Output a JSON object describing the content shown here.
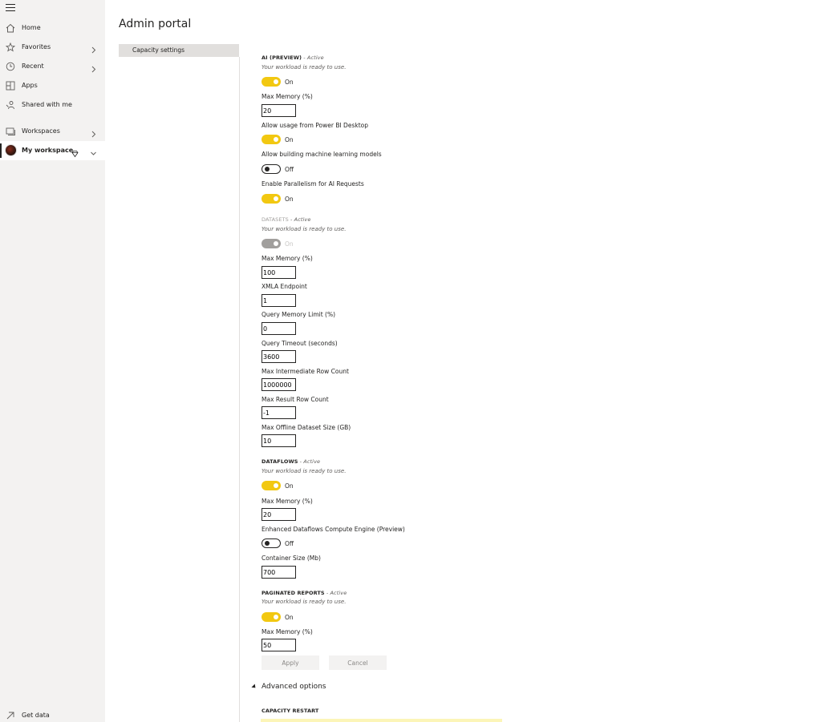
{
  "nav": {
    "items": [
      {
        "label": "Home",
        "icon": "home-icon"
      },
      {
        "label": "Favorites",
        "icon": "star-icon"
      },
      {
        "label": "Recent",
        "icon": "clock-icon"
      },
      {
        "label": "Apps",
        "icon": "apps-icon"
      },
      {
        "label": "Shared with me",
        "icon": "shared-icon"
      },
      {
        "label": "Workspaces",
        "icon": "workspaces-icon"
      },
      {
        "label": "My workspace",
        "icon": "avatar"
      }
    ],
    "get_data": "Get data"
  },
  "page": {
    "title": "Admin portal",
    "subnav_item": "Capacity settings"
  },
  "ai": {
    "name": "AI (PREVIEW)",
    "status": " - Active",
    "note": "Your workload is ready to use.",
    "toggle_label": "On",
    "max_memory_label": "Max Memory (%)",
    "max_memory": "20",
    "desktop_label": "Allow usage from Power BI Desktop",
    "desktop_toggle": "On",
    "ml_label": "Allow building machine learning models",
    "ml_toggle": "Off",
    "parallel_label": "Enable Parallelism for AI Requests",
    "parallel_toggle": "On"
  },
  "datasets": {
    "name": "DATASETS",
    "status": " - Active",
    "note": "Your workload is ready to use.",
    "toggle_label": "On",
    "max_memory_label": "Max Memory (%)",
    "max_memory": "100",
    "xmla_label": "XMLA Endpoint",
    "xmla": "1",
    "query_mem_label": "Query Memory Limit (%)",
    "query_mem": "0",
    "timeout_label": "Query Timeout (seconds)",
    "timeout": "3600",
    "inter_rows_label": "Max Intermediate Row Count",
    "inter_rows": "1000000",
    "result_rows_label": "Max Result Row Count",
    "result_rows": "-1",
    "offline_label": "Max Offline Dataset Size (GB)",
    "offline": "10"
  },
  "dataflows": {
    "name": "DATAFLOWS",
    "status": " - Active",
    "note": "Your workload is ready to use.",
    "toggle_label": "On",
    "max_memory_label": "Max Memory (%)",
    "max_memory": "20",
    "engine_label": "Enhanced Dataflows Compute Engine (Preview)",
    "engine_toggle": "Off",
    "container_label": "Container Size (Mb)",
    "container": "700"
  },
  "paginated": {
    "name": "PAGINATED REPORTS",
    "status": " - Active",
    "note": "Your workload is ready to use.",
    "toggle_label": "On",
    "max_memory_label": "Max Memory (%)",
    "max_memory": "50"
  },
  "actions": {
    "apply": "Apply",
    "cancel": "Cancel",
    "advanced": "Advanced options",
    "restart_head": "CAPACITY RESTART"
  },
  "colors": {
    "toggle_on": "#f2c811",
    "nav_bg": "#f3f2f1",
    "text": "#252423"
  }
}
